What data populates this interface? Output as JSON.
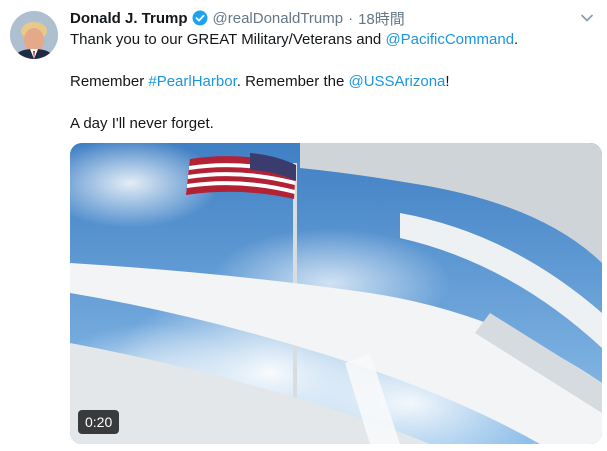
{
  "tweet": {
    "author": {
      "display_name": "Donald J. Trump",
      "handle": "@realDonaldTrump",
      "verified_icon": "verified-badge-icon"
    },
    "separator": "·",
    "timestamp": "18時間",
    "menu_icon": "chevron-down-icon",
    "text": {
      "line1_prefix": "Thank you to our GREAT Military/Veterans and ",
      "line1_mention": "@PacificCommand",
      "line1_suffix": ".",
      "line2_prefix": "Remember ",
      "line2_hashtag": "#PearlHarbor",
      "line2_middle": ". Remember the ",
      "line2_mention": "@USSArizona",
      "line2_suffix": "!",
      "line3": "A day I'll never forget."
    },
    "media": {
      "type": "video",
      "duration": "0:20"
    }
  },
  "colors": {
    "link": "#1b95e0",
    "secondary_text": "#657786",
    "verified": "#1da1f2"
  }
}
